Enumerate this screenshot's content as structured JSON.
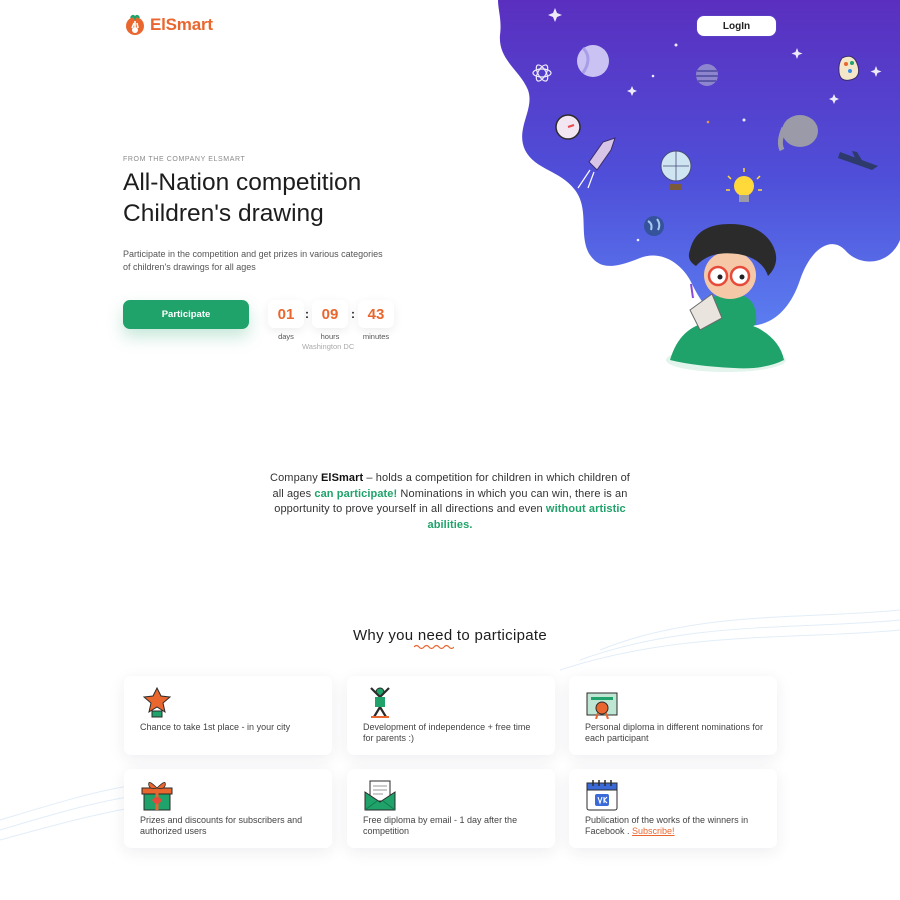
{
  "header": {
    "logo_text": "ElSmart",
    "login_label": "LogIn"
  },
  "hero": {
    "eyebrow": "FROM THE COMPANY ELSMART",
    "title_line1": "All-Nation competition",
    "title_line2": "Children's drawing",
    "subtitle": "Participate in the competition and get prizes in various categories of children's drawings for all ages",
    "cta_label": "Participate",
    "timer": {
      "days": "01",
      "hours": "09",
      "minutes": "43",
      "days_label": "days",
      "hours_label": "hours",
      "minutes_label": "minutes",
      "separator": ":",
      "city": "Washington DC"
    }
  },
  "about": {
    "p1": "Company ",
    "brand": "ElSmart",
    "p2": " – holds a competition for children in which children of all ages ",
    "highlight1": "can participate!",
    "p3": " Nominations in which you can win, there is an opportunity to prove yourself in all directions and even ",
    "highlight2": "without artistic abilities."
  },
  "why": {
    "title": "Why you need to participate",
    "cards": [
      {
        "text": "Chance to take 1st place - in your city",
        "icon": "trophy-star-icon"
      },
      {
        "text": "Development of independence + free time for parents :)",
        "icon": "celebrating-figure-icon"
      },
      {
        "text": "Personal diploma in different nominations for each participant",
        "icon": "diploma-icon"
      },
      {
        "text": "Prizes and discounts for subscribers and authorized users",
        "icon": "gift-box-icon"
      },
      {
        "text": "Free diploma by email - 1 day after the competition",
        "icon": "envelope-icon"
      },
      {
        "text": "Publication of the works of the winners in Facebook . ",
        "link": "Subscribe!",
        "icon": "calendar-icon"
      }
    ]
  },
  "colors": {
    "brand_orange": "#e9672f",
    "brand_green": "#1fa36a",
    "hero_purple": "#5b3cc4"
  }
}
